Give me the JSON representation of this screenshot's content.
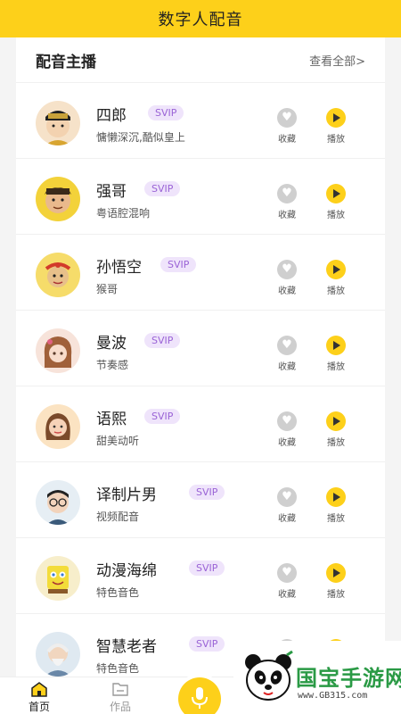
{
  "app": {
    "title": "数字人配音"
  },
  "section": {
    "title": "配音主播",
    "more": "查看全部>"
  },
  "badge": "SVIP",
  "actions": {
    "favorite": "收藏",
    "play": "播放"
  },
  "anchors": [
    {
      "name": "四郎",
      "desc": "慵懒深沉,酷似皇上",
      "avatar": "emperor-avatar"
    },
    {
      "name": "强哥",
      "desc": "粤语腔混响",
      "avatar": "man-avatar"
    },
    {
      "name": "孙悟空",
      "desc": "猴哥",
      "avatar": "monkey-king-avatar"
    },
    {
      "name": "曼波",
      "desc": "节奏感",
      "avatar": "girl-avatar"
    },
    {
      "name": "语熙",
      "desc": "甜美动听",
      "avatar": "woman-avatar"
    },
    {
      "name": "译制片男",
      "desc": "视频配音",
      "avatar": "glasses-man-avatar"
    },
    {
      "name": "动漫海绵",
      "desc": "特色音色",
      "avatar": "sponge-avatar"
    },
    {
      "name": "智慧老者",
      "desc": "特色音色",
      "avatar": "old-man-avatar"
    }
  ],
  "tabs": {
    "home": "首页",
    "works": "作品"
  },
  "watermark": {
    "brand": "国宝手游网",
    "url": "www.GB315.com"
  },
  "colors": {
    "accent": "#fdd01a",
    "badge_bg": "#efe4fb",
    "badge_text": "#9a63d6"
  }
}
